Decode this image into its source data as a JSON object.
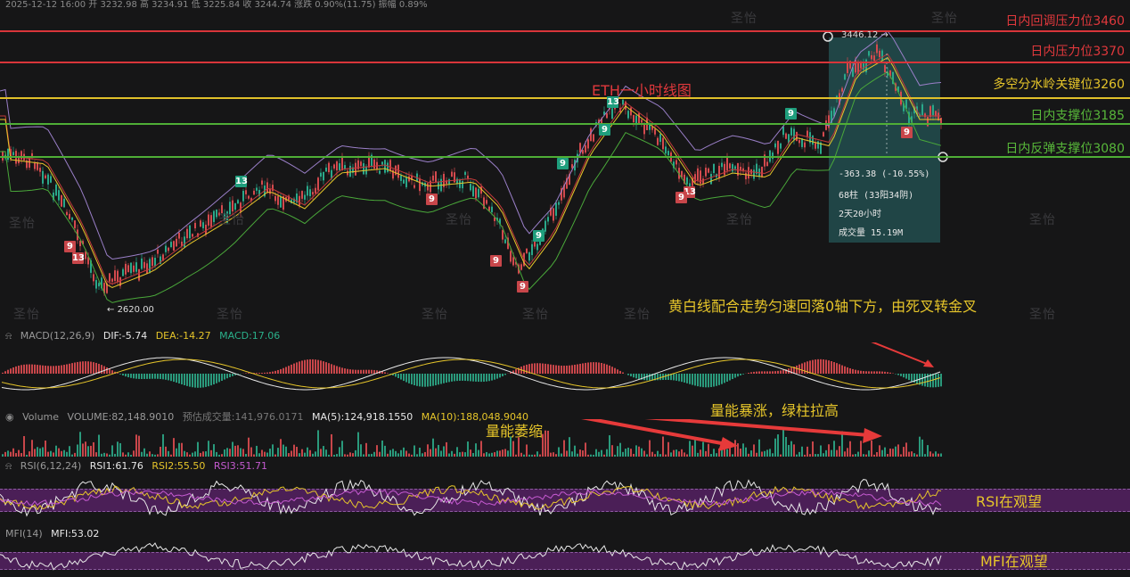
{
  "header": {
    "ohlc_text": "2025-12-12 16:00  开 3232.98  高 3234.91  低 3225.84  收 3244.74  涨跌 0.90%(11.75)  振幅 0.89%"
  },
  "chart": {
    "title": "ETH一小时线图",
    "levels": [
      {
        "label": "日内回调压力位3460",
        "color": "#e0383c"
      },
      {
        "label": "日内压力位3370",
        "color": "#e0383c"
      },
      {
        "label": "多空分水岭关键位3260",
        "color": "#e6c52a"
      },
      {
        "label": "日内支撑位3185",
        "color": "#58b83a"
      },
      {
        "label": "日内反弹支撑位3080",
        "color": "#58b83a"
      }
    ],
    "high_marker": "3446.12",
    "low_marker": "2620.00",
    "td_labels": [
      "13",
      "9",
      "9",
      "9",
      "13",
      "9",
      "9",
      "9",
      "9",
      "13",
      "9",
      "13",
      "9",
      "9"
    ],
    "measure": {
      "change": "-363.38 (-10.55%)",
      "bars": "68柱 (33阳34阴)",
      "duration": "2天20小时",
      "volume": "成交量 15.19M"
    },
    "watermark": "圣怡"
  },
  "macd": {
    "name": "MACD(12,26,9)",
    "dif": "DIF:-5.74",
    "dea": "DEA:-14.27",
    "macd": "MACD:17.06",
    "note": "黄白线配合走势匀速回落0轴下方，由死叉转金叉"
  },
  "volume": {
    "name": "Volume",
    "vol": "VOLUME:82,148.9010",
    "est": "预估成交量:141,976.0171",
    "ma5": "MA(5):124,918.1550",
    "ma10": "MA(10):188,048.9040",
    "note1": "量能萎缩",
    "note2": "量能暴涨，绿柱拉高"
  },
  "rsi": {
    "name": "RSI(6,12,24)",
    "rsi1": "RSI1:61.76",
    "rsi2": "RSI2:55.50",
    "rsi3": "RSI3:51.71",
    "note": "RSI在观望"
  },
  "mfi": {
    "name": "MFI(14)",
    "value": "MFI:53.02",
    "note": "MFI在观望"
  }
}
